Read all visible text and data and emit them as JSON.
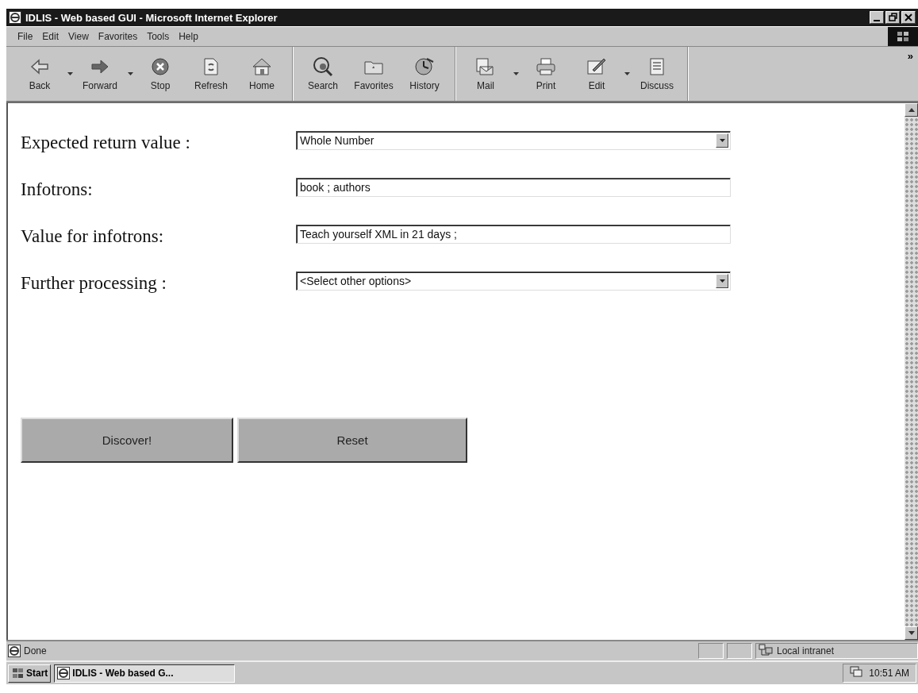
{
  "window": {
    "title": "IDLIS - Web based GUI - Microsoft Internet Explorer"
  },
  "menu": [
    "File",
    "Edit",
    "View",
    "Favorites",
    "Tools",
    "Help"
  ],
  "toolbar": {
    "groups": [
      [
        {
          "label": "Back",
          "dropdown": true
        },
        {
          "label": "Forward",
          "dropdown": true
        },
        {
          "label": "Stop",
          "dropdown": false
        },
        {
          "label": "Refresh",
          "dropdown": false
        },
        {
          "label": "Home",
          "dropdown": false
        }
      ],
      [
        {
          "label": "Search",
          "dropdown": false
        },
        {
          "label": "Favorites",
          "dropdown": false
        },
        {
          "label": "History",
          "dropdown": false
        }
      ],
      [
        {
          "label": "Mail",
          "dropdown": true
        },
        {
          "label": "Print",
          "dropdown": false
        },
        {
          "label": "Edit",
          "dropdown": true
        },
        {
          "label": "Discuss",
          "dropdown": false
        }
      ]
    ],
    "chevron": "»"
  },
  "form": {
    "fields": [
      {
        "kind": "select",
        "label": "Expected return value :",
        "value": "Whole Number"
      },
      {
        "kind": "text",
        "label": "Infotrons:",
        "value": "book ; authors"
      },
      {
        "kind": "text",
        "label": "Value for infotrons:",
        "value": "Teach yourself XML in 21 days ;"
      },
      {
        "kind": "select",
        "label": "Further processing :",
        "value": "<Select other options>"
      }
    ],
    "buttons": [
      "Discover!",
      "Reset"
    ]
  },
  "status_bar": {
    "text": "Done",
    "zone": "Local intranet"
  },
  "taskbar": {
    "start": "Start",
    "task": "IDLIS - Web based G...",
    "clock": "10:51 AM"
  }
}
